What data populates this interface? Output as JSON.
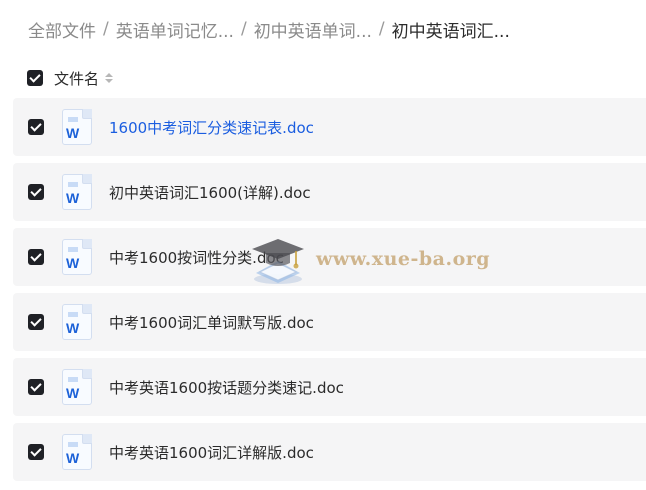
{
  "breadcrumb": {
    "items": [
      "全部文件",
      "英语单词记忆...",
      "初中英语单词...",
      "初中英语词汇..."
    ],
    "separator": "/"
  },
  "list_header": {
    "label": "文件名"
  },
  "files": [
    {
      "name": "1600中考词汇分类速记表.doc",
      "icon": "word-doc-icon"
    },
    {
      "name": "初中英语词汇1600(详解).doc",
      "icon": "word-doc-icon"
    },
    {
      "name": "中考1600按词性分类.doc",
      "icon": "word-doc-icon"
    },
    {
      "name": "中考1600词汇单词默写版.doc",
      "icon": "word-doc-icon"
    },
    {
      "name": "中考英语1600按话题分类速记.doc",
      "icon": "word-doc-icon"
    },
    {
      "name": "中考英语1600词汇详解版.doc",
      "icon": "word-doc-icon"
    }
  ],
  "watermark": {
    "text": "www.xue-ba.org"
  },
  "colors": {
    "accent": "#1a5de0",
    "row_bg": "#f5f5f6",
    "checkbox": "#1f2126",
    "word_blue": "#1d62d8"
  }
}
